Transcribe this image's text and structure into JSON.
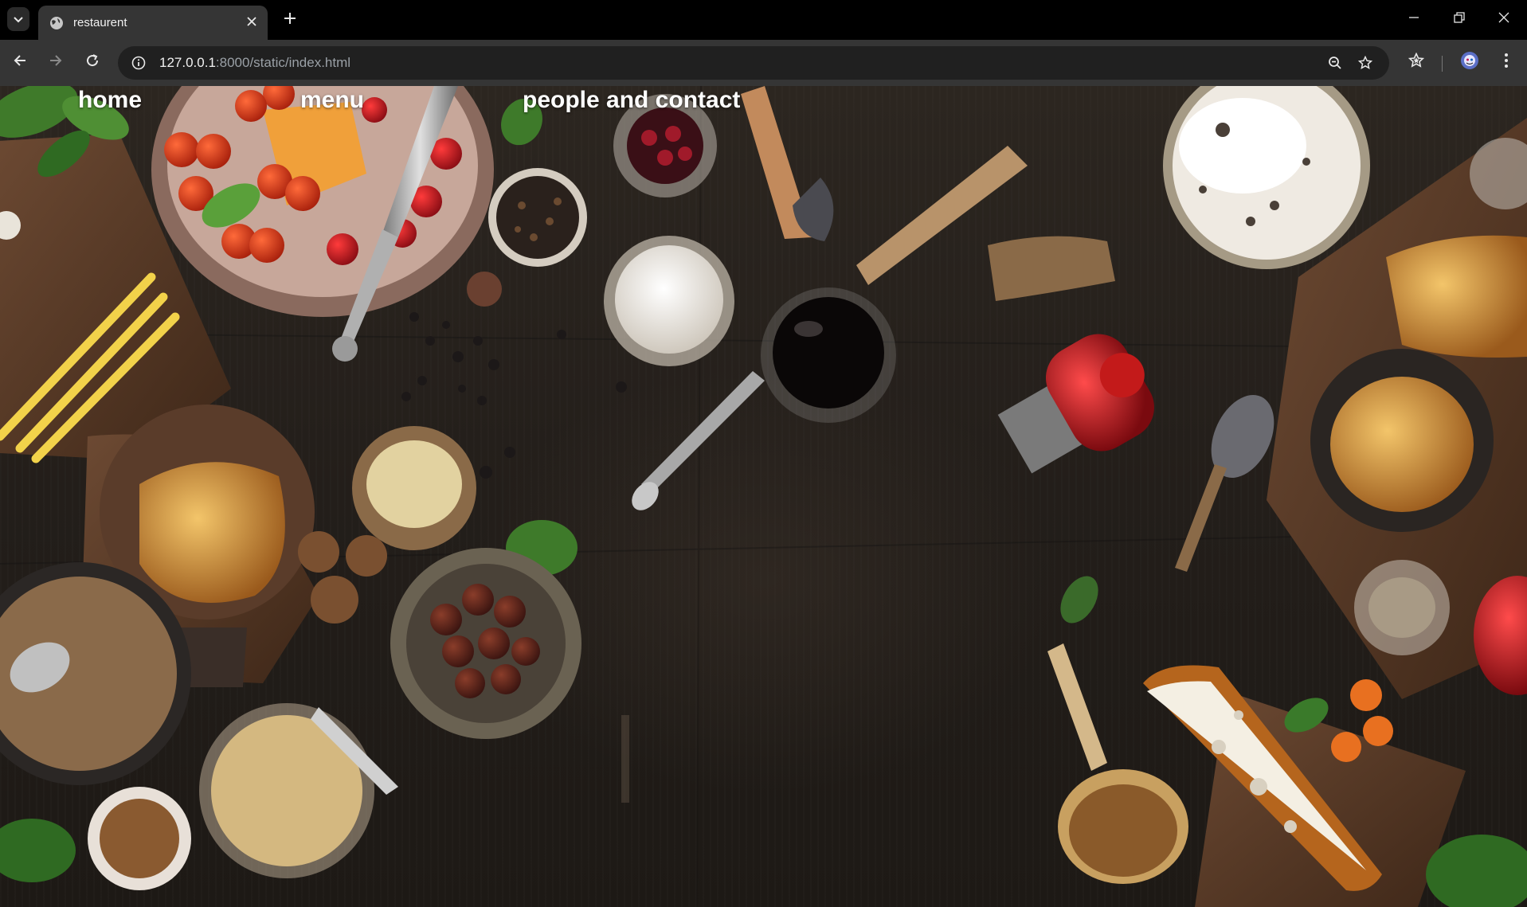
{
  "browser": {
    "tab_title": "restaurent",
    "url_host": "127.0.0.1",
    "url_rest": ":8000/static/index.html"
  },
  "nav": {
    "home": "home",
    "menu": "menu",
    "people": "people and contact"
  },
  "icons": {
    "tab_search": "chevron-down-icon",
    "favicon": "globe-icon",
    "close": "close-icon",
    "new_tab": "plus-icon",
    "back": "back-arrow-icon",
    "forward": "forward-arrow-icon",
    "reload": "reload-icon",
    "site_info": "info-icon",
    "zoom": "zoom-out-icon",
    "bookmark": "star-icon",
    "bookmarks": "bookmarks-icon",
    "profile": "avatar-icon",
    "menu": "kebab-menu-icon"
  },
  "colors": {
    "chrome_bg": "#000000",
    "toolbar_bg": "#353535",
    "omnibox_bg": "#202020",
    "page_bg": "#231e1a"
  }
}
